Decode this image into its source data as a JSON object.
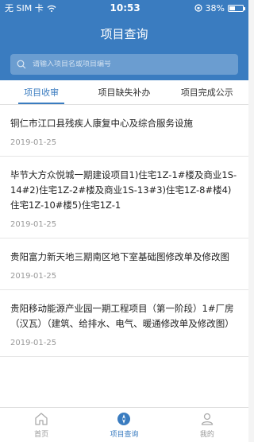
{
  "status": {
    "carrier": "无 SIM 卡",
    "time": "10:53",
    "battery": "38%"
  },
  "nav": {
    "title": "项目查询"
  },
  "search": {
    "placeholder": "请输入项目名或项目编号"
  },
  "tabs": [
    {
      "label": "项目收审",
      "active": true
    },
    {
      "label": "项目缺失补办",
      "active": false
    },
    {
      "label": "项目完成公示",
      "active": false
    }
  ],
  "items": [
    {
      "title": "铜仁市江口县残疾人康复中心及综合服务设施",
      "date": "2019-01-25"
    },
    {
      "title": "毕节大方众悦城一期建设项目1)住宅1Z-1#楼及商业1S-14#2)住宅1Z-2#楼及商业1S-13#3)住宅1Z-8#楼4)住宅1Z-10#楼5)住宅1Z-1",
      "date": "2019-01-25"
    },
    {
      "title": "贵阳富力新天地三期南区地下室基础图修改单及修改图",
      "date": "2019-01-25"
    },
    {
      "title": "贵阳移动能源产业园一期工程项目（第一阶段）1#厂房（汉瓦）（建筑、给排水、电气、暖通修改单及修改图）",
      "date": "2019-01-25"
    }
  ],
  "tabbar": [
    {
      "label": "首页",
      "icon": "home-icon",
      "active": false
    },
    {
      "label": "项目查询",
      "icon": "compass-icon",
      "active": true
    },
    {
      "label": "我的",
      "icon": "user-icon",
      "active": false
    }
  ],
  "colors": {
    "primary": "#3a7cc0"
  }
}
